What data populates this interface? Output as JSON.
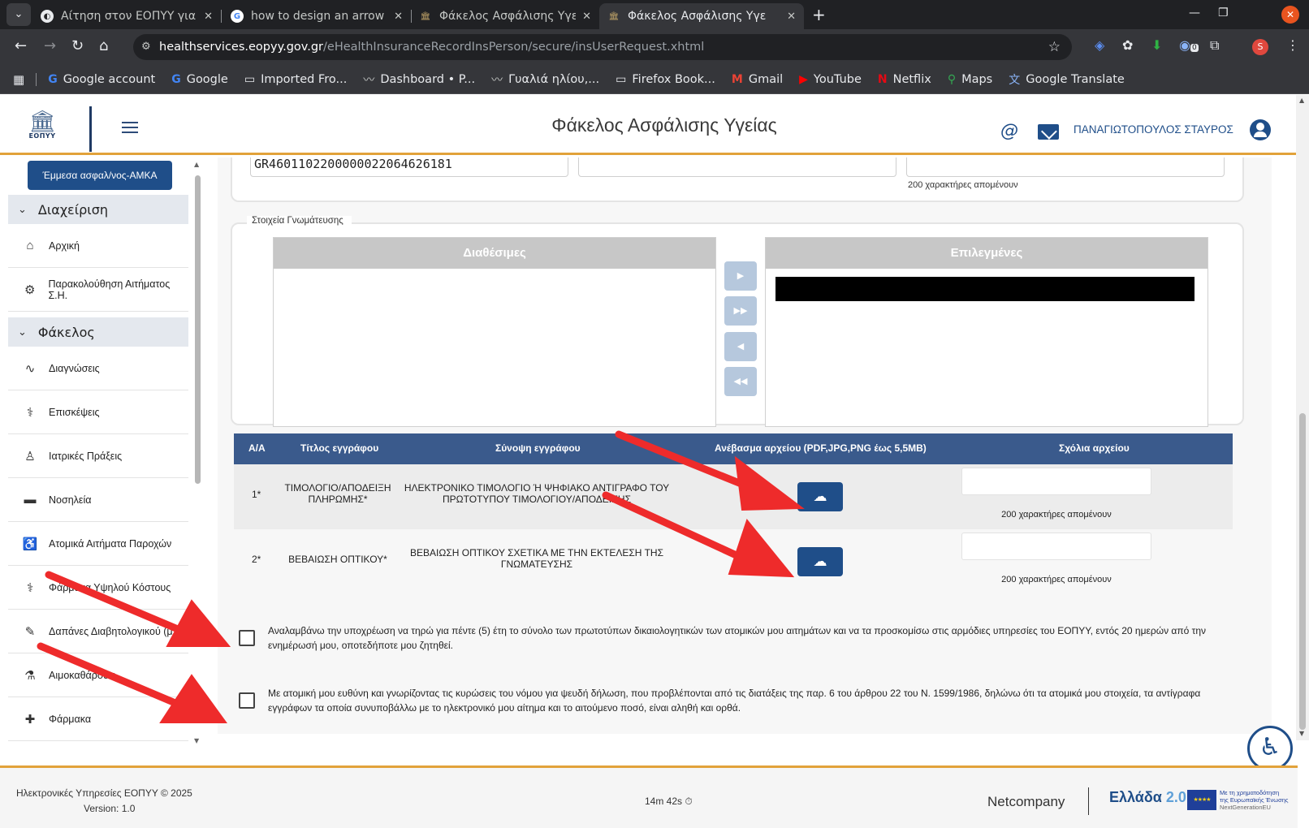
{
  "browser": {
    "tabs": [
      {
        "title": "Αίτηση στον ΕΟΠΥΥ για v"
      },
      {
        "title": "how to design an arrow v"
      },
      {
        "title": "Φάκελος Ασφάλισης Υγε"
      },
      {
        "title": "Φάκελος Ασφάλισης Υγε"
      }
    ],
    "url_host": "healthservices.eopyy.gov.gr",
    "url_path": "/eHealthInsuranceRecordInsPerson/secure/insUserRequest.xhtml",
    "profile_initial": "S",
    "extension_badge": "0",
    "bookmarks": [
      {
        "label": "Google account",
        "icon": "google-icon"
      },
      {
        "label": "Google",
        "icon": "google-icon"
      },
      {
        "label": "Imported Fro...",
        "icon": "folder-icon"
      },
      {
        "label": "Dashboard • P...",
        "icon": "site-icon"
      },
      {
        "label": "Γυαλιά ηλίου,...",
        "icon": "site-icon"
      },
      {
        "label": "Firefox Book...",
        "icon": "folder-icon"
      },
      {
        "label": "Gmail",
        "icon": "gmail-icon"
      },
      {
        "label": "YouTube",
        "icon": "youtube-icon"
      },
      {
        "label": "Netflix",
        "icon": "netflix-icon"
      },
      {
        "label": "Maps",
        "icon": "maps-icon"
      },
      {
        "label": "Google Translate",
        "icon": "translate-icon"
      }
    ]
  },
  "header": {
    "logo_text": "ΕΟΠΥΥ",
    "title": "Φάκελος Ασφάλισης Υγείας",
    "user_name": "ΠΑΝΑΓΙΩΤΟΠΟΥΛΟΣ ΣΤΑΥΡΟΣ",
    "at_symbol": "@"
  },
  "sidebar": {
    "top_button": "Έμμεσα ασφαλ/νος-ΑΜΚΑ",
    "group1": "Διαχείριση",
    "group1_items": [
      {
        "label": "Αρχική",
        "icon": "home-icon"
      },
      {
        "label": "Παρακολούθηση Αιτήματος Σ.Η.",
        "icon": "gear-icon"
      }
    ],
    "group2": "Φάκελος",
    "group2_items": [
      {
        "label": "Διαγνώσεις",
        "icon": "pulse-icon"
      },
      {
        "label": "Επισκέψεις",
        "icon": "doctor-visit-icon"
      },
      {
        "label": "Ιατρικές Πράξεις",
        "icon": "medical-procedure-icon"
      },
      {
        "label": "Νοσηλεία",
        "icon": "hospital-bed-icon"
      },
      {
        "label": "Ατομικά Αιτήματα Παροχών",
        "icon": "wheelchair-icon"
      },
      {
        "label": "Φάρμακα Υψηλού Κόστους",
        "icon": "pill-icon"
      },
      {
        "label": "Δαπάνες Διαβητολογικού (μ",
        "icon": "diabetes-icon"
      },
      {
        "label": "Αιμοκαθάρσεις",
        "icon": "dialysis-icon"
      },
      {
        "label": "Φάρμακα",
        "icon": "medicine-icon"
      }
    ]
  },
  "form": {
    "iban_value": "GR4601102200000022064626181",
    "chars_remaining_top": "200 χαρακτήρες απομένουν",
    "prescription_legend": "Στοιχεία Γνωμάτευσης",
    "available_header": "Διαθέσιμες",
    "selected_header": "Επιλεγμένες",
    "pick_buttons": [
      "▶",
      "▶▶",
      "◀",
      "◀◀"
    ]
  },
  "documents": {
    "columns": [
      "Α/Α",
      "Τίτλος εγγράφου",
      "Σύνοψη εγγράφου",
      "Ανέβασμα αρχείου (PDF,JPG,PNG έως 5,5MB)",
      "Σχόλια αρχείου"
    ],
    "rows": [
      {
        "no": "1*",
        "title_line1": "ΤΙΜΟΛΟΓΙΟ/ΑΠΟΔΕΙΞΗ",
        "title_line2": "ΠΛΗΡΩΜΗΣ*",
        "summary_line1": "ΗΛΕΚΤΡΟΝΙΚΟ ΤΙΜΟΛΟΓΙΟ Ή ΨΗΦΙΑΚΟ ΑΝΤΙΓΡΑΦΟ ΤΟΥ",
        "summary_line2": "ΠΡΩΤΟΤΥΠΟΥ ΤΙΜΟΛΟΓΙΟΥ/ΑΠΟΔΕΙΞΗΣ",
        "chars_remaining": "200 χαρακτήρες απομένουν"
      },
      {
        "no": "2*",
        "title_line1": "ΒΕΒΑΙΩΣΗ ΟΠΤΙΚΟΥ*",
        "title_line2": "",
        "summary_line1": "ΒΕΒΑΙΩΣΗ ΟΠΤΙΚΟΥ ΣΧΕΤΙΚΑ ΜΕ ΤΗΝ ΕΚΤΕΛΕΣΗ ΤΗΣ",
        "summary_line2": "ΓΝΩΜΑΤΕΥΣΗΣ",
        "chars_remaining": "200 χαρακτήρες απομένουν"
      }
    ]
  },
  "declarations": {
    "decl1": "Αναλαμβάνω την υποχρέωση να τηρώ για πέντε (5) έτη το σύνολο των πρωτοτύπων δικαιολογητικών των ατομικών μου αιτημάτων και να τα προσκομίσω στις αρμόδιες υπηρεσίες του ΕΟΠΥΥ, εντός 20 ημερών από την ενημέρωσή μου, οποτεδήποτε μου ζητηθεί.",
    "decl2": "Με ατομική μου ευθύνη και γνωρίζοντας τις κυρώσεις του νόμου για ψευδή δήλωση, που προβλέπονται από τις διατάξεις της παρ. 6 του άρθρου 22 του Ν. 1599/1986, δηλώνω ότι τα ατομικά μου στοιχεία, τα αντίγραφα εγγράφων τα οποία συνυποβάλλω με το ηλεκτρονικό μου αίτημα και το αιτούμενο ποσό, είναι αληθή και ορθά."
  },
  "footer": {
    "copyright": "Ηλεκτρονικές Υπηρεσίες ΕΟΠΥΥ © 2025",
    "version": "Version: 1.0",
    "timer": "14m 42s",
    "company": "Netcompany",
    "greece_logo": "Ελλάδα",
    "greece_logo_num": "2.0",
    "eu_text_line1": "Με τη χρηματοδότηση",
    "eu_text_line2": "της Ευρωπαϊκής Ένωσης",
    "eu_text_line3": "NextGenerationEU"
  },
  "colors": {
    "brand_blue": "#1f4e89",
    "table_header": "#3a5a8c",
    "accent_orange": "#e2a23a",
    "annotation_red": "#ee2b2b"
  }
}
